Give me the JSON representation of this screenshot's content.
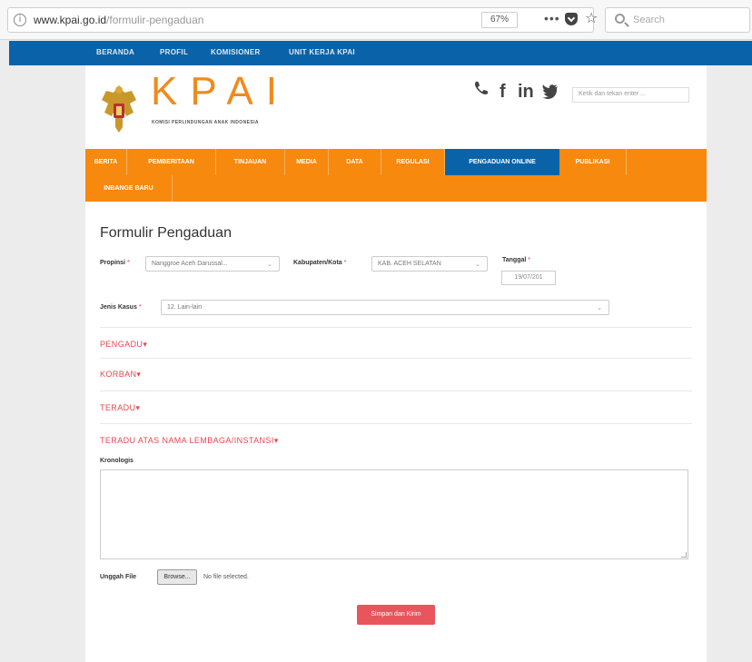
{
  "browser": {
    "url_domain": "www.kpai.go.id",
    "url_path": "/formulir-pengaduan",
    "zoom": "67%",
    "search_placeholder": "Search"
  },
  "top_nav": [
    "BERANDA",
    "PROFIL",
    "KOMISIONER",
    "UNIT KERJA KPAI"
  ],
  "header": {
    "logo_text": "KPAI",
    "logo_subtitle": "KOMISI PERLINDUNGAN ANAK INDONESIA",
    "search_placeholder": "Ketik dan tekan enter ..."
  },
  "main_menu": [
    {
      "label": "BERITA",
      "active": false
    },
    {
      "label": "PEMBERITAAN",
      "active": false
    },
    {
      "label": "TINJAUAN",
      "active": false
    },
    {
      "label": "MEDIA",
      "active": false
    },
    {
      "label": "DATA",
      "active": false
    },
    {
      "label": "REGULASI",
      "active": false
    },
    {
      "label": "PENGADUAN ONLINE",
      "active": true
    },
    {
      "label": "PUBLIKASI",
      "active": false
    },
    {
      "label": "INBANGE BARU",
      "active": false
    }
  ],
  "form": {
    "title": "Formulir Pengaduan",
    "provinsi_label": "Propinsi",
    "provinsi_value": "Nanggroe Aceh Darussal...",
    "kabupaten_label": "Kabupaten/Kota",
    "kabupaten_value": "KAB. ACEH SELATAN",
    "tanggal_label": "Tanggal",
    "tanggal_value": "19/07/201",
    "jenis_kasus_label": "Jenis Kasus",
    "jenis_kasus_value": "12. Lain-lain",
    "required_mark": "*",
    "sections": [
      "PENGADU",
      "KORBAN",
      "TERADU",
      "TERADU ATAS NAMA LEMBAGA/INSTANSI"
    ],
    "kronologis_label": "Kronologis",
    "file_label": "Unggah File",
    "browse_label": "Browse...",
    "no_file_text": "No file selected.",
    "submit_label": "Simpan dan Kirim"
  },
  "colors": {
    "blue": "#0a63a8",
    "orange": "#f7890e",
    "section_red": "#e8474e",
    "submit_red": "#e8555d"
  }
}
